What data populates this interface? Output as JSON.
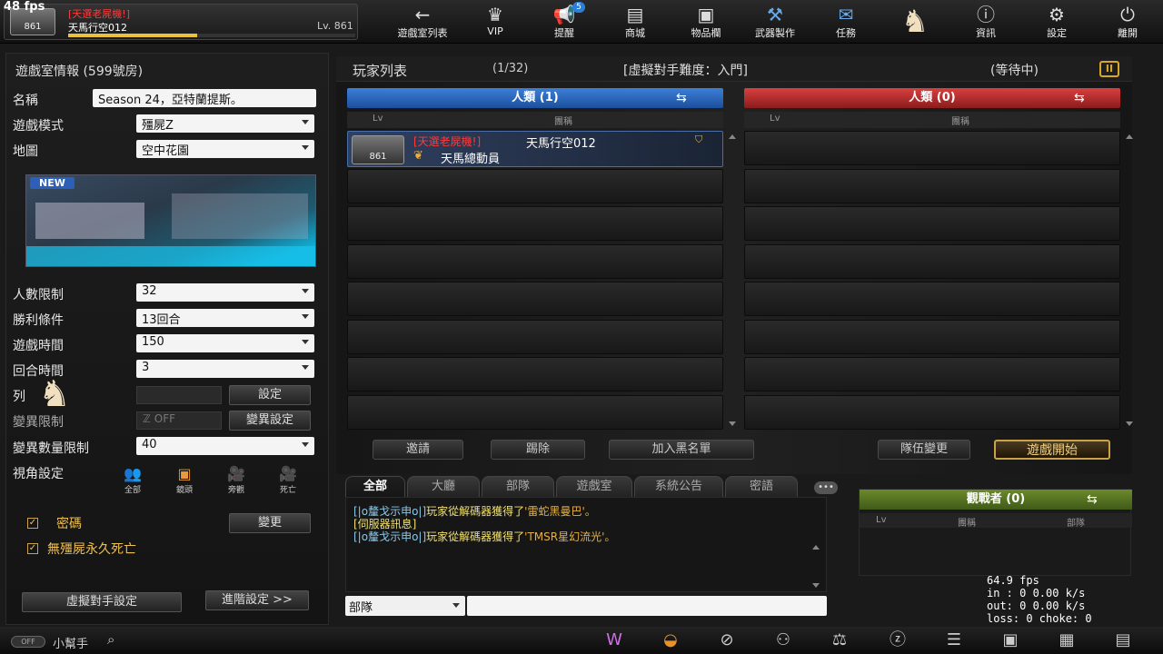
{
  "fps_overlay": "48 fps",
  "profile": {
    "rank": "861",
    "title": "[天選老屍機!]",
    "name": "天馬行空012",
    "level": "Lv. 861",
    "exp_progress": 0.45
  },
  "nav": [
    {
      "label": "遊戲室列表",
      "icon": "back-arrow-icon"
    },
    {
      "label": "VIP",
      "icon": "crown-icon"
    },
    {
      "label": "提醒",
      "icon": "megaphone-icon",
      "badge": "5"
    },
    {
      "label": "商城",
      "icon": "shop-icon"
    },
    {
      "label": "物品欄",
      "icon": "bag-icon"
    },
    {
      "label": "武器製作",
      "icon": "weapon-icon"
    },
    {
      "label": "任務",
      "icon": "mission-icon"
    },
    {
      "label": "",
      "icon": "horse-mascot-icon"
    },
    {
      "label": "資訊",
      "icon": "info-icon"
    },
    {
      "label": "設定",
      "icon": "gear-icon"
    },
    {
      "label": "離開",
      "icon": "power-icon"
    }
  ],
  "room": {
    "title": "遊戲室情報 (599號房)",
    "name_label": "名稱",
    "name_value": "Season 24，亞特蘭提斯。",
    "mode_label": "遊戲模式",
    "mode_value": "殭屍Z",
    "map_label": "地圖",
    "map_value": "空中花園",
    "map_new": "NEW",
    "players_label": "人數限制",
    "players_value": "32",
    "win_label": "勝利條件",
    "win_value": "13回合",
    "time_label": "遊戲時間",
    "time_value": "150",
    "round_label": "回合時間",
    "round_value": "3",
    "row9_label": "列",
    "set_btn": "設定",
    "mutation_label": "變異限制",
    "mutation_toggle": "OFF",
    "mutation_btn": "變異設定",
    "mutation_count_label": "變異數量限制",
    "mutation_count_value": "40",
    "view_label": "視角設定",
    "views": [
      {
        "label": "全部"
      },
      {
        "label": "鏡頭"
      },
      {
        "label": "旁觀"
      },
      {
        "label": "死亡"
      }
    ],
    "password_label": "密碼",
    "password_checked": true,
    "nozombie_label": "無殭屍永久死亡",
    "nozombie_checked": true,
    "change_btn": "變更",
    "bot_btn": "虛擬對手設定",
    "advanced_btn": "進階設定 >>"
  },
  "player_list": {
    "title": "玩家列表",
    "count": "(1/32)",
    "difficulty": "[虛擬對手難度：入門]",
    "status": "(等待中)",
    "team_left": {
      "label": "人類 (1)",
      "color": "#2d6fc4"
    },
    "team_right": {
      "label": "人類 (0)",
      "color": "#c43030"
    },
    "col_lv": "Lv",
    "col_clan": "團稱",
    "players": [
      {
        "rank": "861",
        "title": "[天選老屍機!]",
        "name": "天馬行空012",
        "clan": "天馬總動員"
      }
    ]
  },
  "actions": {
    "invite": "邀請",
    "kick": "踢除",
    "blacklist": "加入黑名單",
    "team_change": "隊伍變更",
    "start": "遊戲開始"
  },
  "chat": {
    "tabs": [
      "全部",
      "大廳",
      "部隊",
      "遊戲室",
      "系統公告",
      "密語"
    ],
    "lines": [
      {
        "prefix": "[|o釐戈示申o|]",
        "text": "玩家從解碼器獲得了",
        "item": "'雷蛇黑曼巴'。"
      },
      {
        "prefix": "[伺服器訊息]",
        "text": "",
        "item": ""
      },
      {
        "prefix": "[|o釐戈示申o|]",
        "text": "玩家從解碼器獲得了",
        "item": "'TMSR星幻流光'。"
      }
    ],
    "channel": "部隊",
    "input_value": ""
  },
  "spectator": {
    "title": "觀戰者 (0)",
    "col_lv": "Lv",
    "col_clan": "團稱",
    "col_unit": "部隊"
  },
  "netstats": [
    "64.9 fps",
    "in :  0 0.00 k/s",
    "out:  0 0.00 k/s",
    "loss: 0 choke:  0"
  ],
  "bottom": {
    "toggle": "OFF",
    "helper": "小幫手"
  }
}
